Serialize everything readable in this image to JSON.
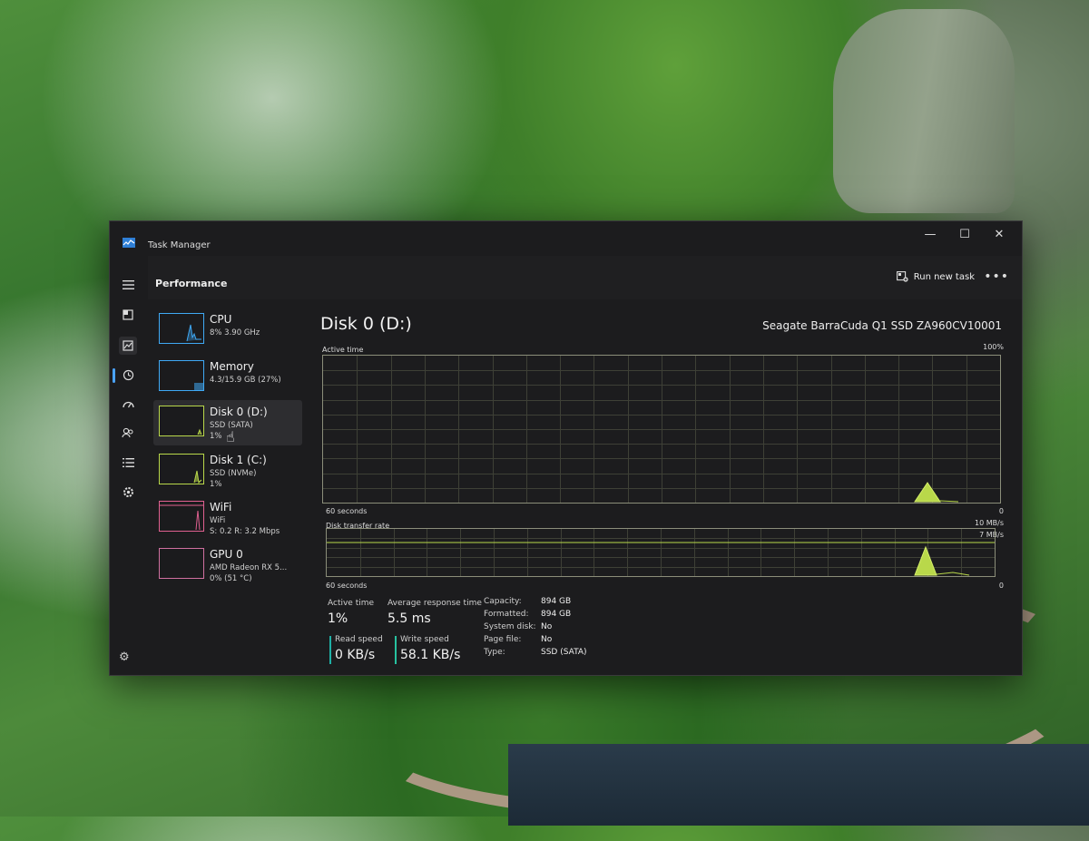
{
  "window": {
    "title": "Task Manager",
    "minimize_glyph": "—",
    "maximize_glyph": "☐",
    "close_glyph": "✕"
  },
  "header": {
    "section_title": "Performance",
    "run_new_task_label": "Run new task",
    "more_glyph": "•••"
  },
  "rail_icons": [
    "hamburger-icon",
    "processes-icon",
    "performance-icon",
    "app-history-icon",
    "startup-apps-icon",
    "users-icon",
    "details-icon",
    "services-icon"
  ],
  "devices": [
    {
      "name": "CPU",
      "sub": "8% 3.90 GHz",
      "sub2": "",
      "color": "#3fa9f5"
    },
    {
      "name": "Memory",
      "sub": "4.3/15.9 GB (27%)",
      "sub2": "",
      "color": "#3fa9f5"
    },
    {
      "name": "Disk 0 (D:)",
      "sub": "SSD (SATA)",
      "sub2": "1%",
      "color": "#b9d84a"
    },
    {
      "name": "Disk 1 (C:)",
      "sub": "SSD (NVMe)",
      "sub2": "1%",
      "color": "#b9d84a"
    },
    {
      "name": "WiFi",
      "sub": "WiFi",
      "sub2": "S: 0.2 R: 3.2 Mbps",
      "color": "#e06090"
    },
    {
      "name": "GPU 0",
      "sub": "AMD Radeon RX 5...",
      "sub2": "0% (51 °C)",
      "color": "#d070a0"
    }
  ],
  "main": {
    "title": "Disk 0 (D:)",
    "model": "Seagate BarraCuda Q1 SSD ZA960CV10001",
    "active_time": {
      "label": "Active time",
      "max_label": "100%",
      "time_label": "60 seconds",
      "min_label": "0"
    },
    "transfer_rate": {
      "label": "Disk transfer rate",
      "max_label": "10 MB/s",
      "line_label": "7 MB/s",
      "time_label": "60 seconds",
      "min_label": "0"
    },
    "stats": {
      "active_time_label": "Active time",
      "active_time_value": "1%",
      "avg_response_label": "Average response time",
      "avg_response_value": "5.5 ms",
      "read_speed_label": "Read speed",
      "read_speed_value": "0 KB/s",
      "write_speed_label": "Write speed",
      "write_speed_value": "58.1 KB/s"
    },
    "properties": [
      {
        "key": "Capacity:",
        "value": "894 GB"
      },
      {
        "key": "Formatted:",
        "value": "894 GB"
      },
      {
        "key": "System disk:",
        "value": "No"
      },
      {
        "key": "Page file:",
        "value": "No"
      },
      {
        "key": "Type:",
        "value": "SSD (SATA)"
      }
    ]
  },
  "colors": {
    "accent": "#4aa3ff",
    "disk": "#b9d84a",
    "read_accent": "#1fb0a6",
    "write_accent": "#27c2a0"
  }
}
